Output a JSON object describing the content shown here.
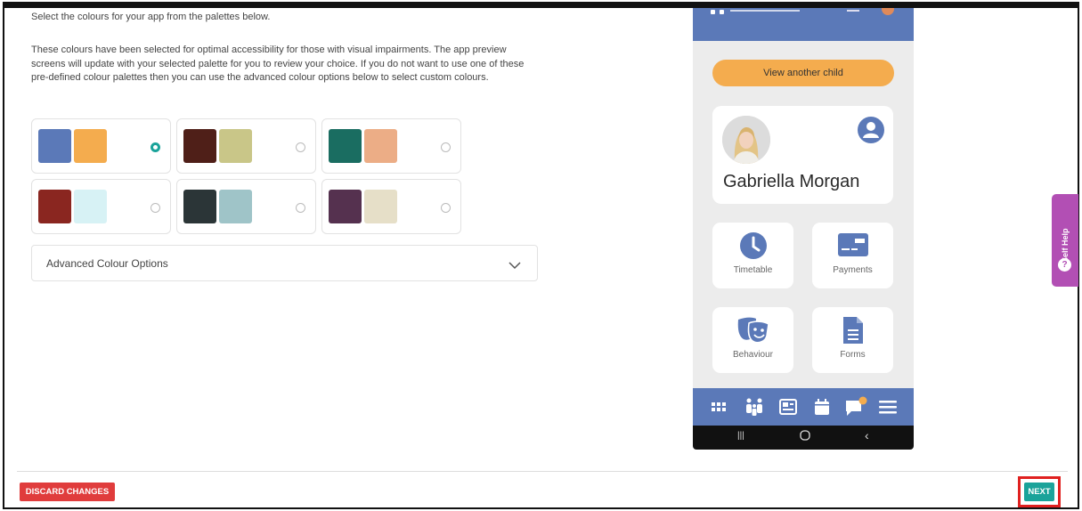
{
  "intro": {
    "top_line": "Select the colours for your app from the palettes below.",
    "paragraph": "These colours have been selected for optimal accessibility for those with visual impairments. The app preview screens will update with your selected palette for you to review your choice. If you do not want to use one of these pre-defined colour palettes then you can use the advanced colour options below to select custom colours."
  },
  "palettes": [
    {
      "primary": "#5b79b8",
      "secondary": "#f4ac4e",
      "selected": true
    },
    {
      "primary": "#4f1f18",
      "secondary": "#c9c688",
      "selected": false
    },
    {
      "primary": "#1a6d61",
      "secondary": "#ecad86",
      "selected": false
    },
    {
      "primary": "#8a2620",
      "secondary": "#d7f2f5",
      "selected": false
    },
    {
      "primary": "#2b3537",
      "secondary": "#9fc4c8",
      "selected": false
    },
    {
      "primary": "#55314f",
      "secondary": "#e6dfc8",
      "selected": false
    }
  ],
  "advanced": {
    "label": "Advanced Colour Options",
    "icon": "chevron-down-icon"
  },
  "preview": {
    "view_another_child": "View another child",
    "child_name": "Gabriella Morgan",
    "tiles": {
      "timetable": "Timetable",
      "payments": "Payments",
      "behaviour": "Behaviour",
      "forms": "Forms"
    },
    "tab_icons": [
      "grid-icon",
      "family-icon",
      "news-icon",
      "calendar-icon",
      "chat-icon",
      "menu-icon"
    ],
    "nav_icons": [
      "recent-apps-icon",
      "home-icon",
      "back-icon"
    ],
    "nav_glyphs": {
      "recents": "|||",
      "back": "‹"
    }
  },
  "self_help": {
    "label": "Self Help",
    "badge": "?"
  },
  "footer": {
    "discard_label": "DISCARD CHANGES",
    "next_label": "NEXT"
  },
  "colors": {
    "accent_teal": "#1aa39a",
    "danger_red": "#e03c3c",
    "self_help_purple": "#b24fb4",
    "app_blue": "#5b79b8",
    "app_orange": "#f4ac4e"
  }
}
